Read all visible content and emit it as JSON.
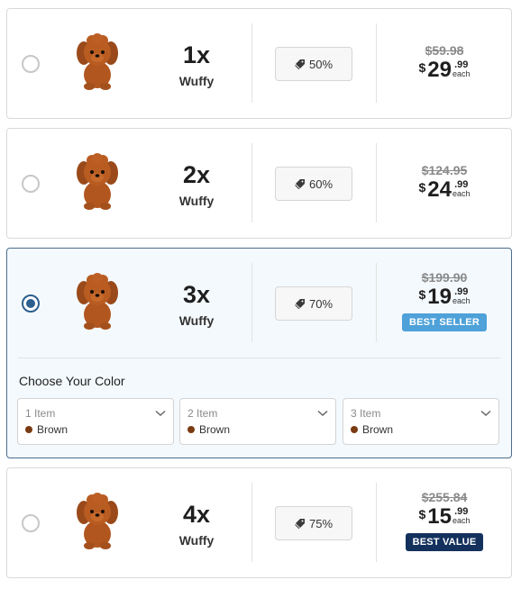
{
  "product_name": "Wuffy",
  "color_section": {
    "title": "Choose Your Color",
    "selects": [
      {
        "item_label": "1 Item",
        "color_name": "Brown"
      },
      {
        "item_label": "2 Item",
        "color_name": "Brown"
      },
      {
        "item_label": "3 Item",
        "color_name": "Brown"
      }
    ]
  },
  "bundles": [
    {
      "qty": "1x",
      "name": "Wuffy",
      "discount": "50%",
      "old_price": "$59.98",
      "currency": "$",
      "price_int": "29",
      "price_cents": ".99",
      "each": "each",
      "badge": "",
      "selected": false
    },
    {
      "qty": "2x",
      "name": "Wuffy",
      "discount": "60%",
      "old_price": "$124.95",
      "currency": "$",
      "price_int": "24",
      "price_cents": ".99",
      "each": "each",
      "badge": "",
      "selected": false
    },
    {
      "qty": "3x",
      "name": "Wuffy",
      "discount": "70%",
      "old_price": "$199.90",
      "currency": "$",
      "price_int": "19",
      "price_cents": ".99",
      "each": "each",
      "badge": "BEST SELLER",
      "selected": true
    },
    {
      "qty": "4x",
      "name": "Wuffy",
      "discount": "75%",
      "old_price": "$255.84",
      "currency": "$",
      "price_int": "15",
      "price_cents": ".99",
      "each": "each",
      "badge": "BEST VALUE",
      "selected": false
    }
  ],
  "colors": {
    "selected_border": "#4a6d8c",
    "radio_checked": "#2c5f8e",
    "best_seller_badge": "#4ea1d9",
    "best_value_badge": "#13315c",
    "swatch_brown": "#7a3b12"
  },
  "icons": {
    "discount": "tag-icon",
    "select": "chevron-down-icon",
    "product_image": "plush-puppy-image"
  }
}
